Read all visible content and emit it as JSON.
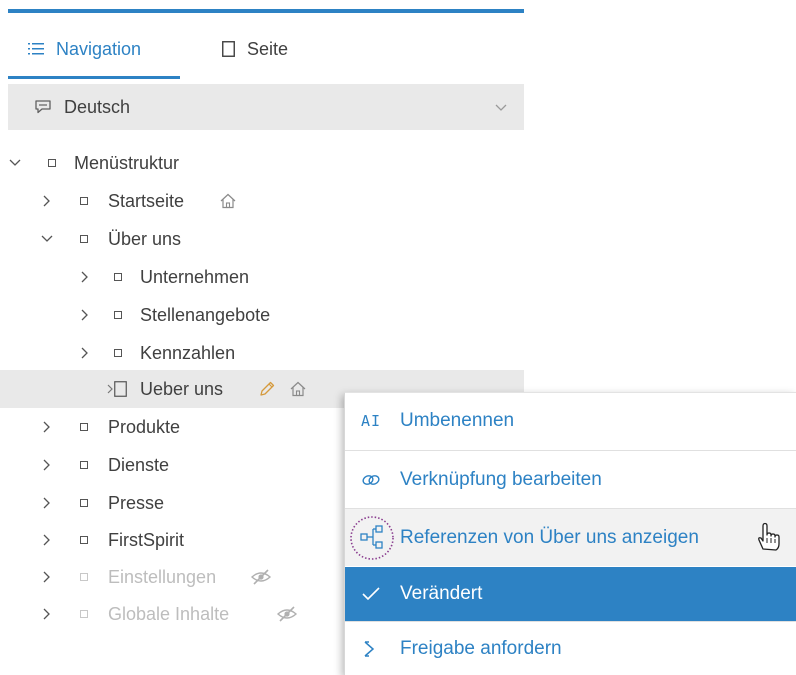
{
  "tabs": {
    "navigation": "Navigation",
    "page": "Seite"
  },
  "language": {
    "selected": "Deutsch"
  },
  "tree": {
    "root": "Menüstruktur",
    "items": [
      "Startseite",
      "Über uns",
      "Unternehmen",
      "Stellenangebote",
      "Kennzahlen",
      "Ueber uns",
      "Produkte",
      "Dienste",
      "Presse",
      "FirstSpirit",
      "Einstellungen",
      "Globale Inhalte"
    ]
  },
  "context_menu": {
    "items": [
      "Umbenennen",
      "Verknüpfung bearbeiten",
      "Referenzen von Über uns anzeigen",
      "Verändert",
      "Freigabe anfordern"
    ],
    "rename_icon_text": "AI"
  },
  "colors": {
    "accent": "#2d82c4",
    "selected_row": "#e9e9e9",
    "muted_text": "#bdbdbd",
    "hover_row": "#f2f2f2",
    "highlight_ring": "#8a3d8f"
  },
  "icons": {
    "nav_tab": "list-icon",
    "page_tab": "page-icon",
    "language": "speech-bubble-icon",
    "home": "home-icon",
    "edit": "pencil-icon",
    "hidden": "eye-slash-icon",
    "rename": "rename-icon",
    "link": "link-icon",
    "references": "sitemap-icon",
    "changed": "checkmark-icon",
    "release": "chevron-stage-icon",
    "cursor": "hand-pointer-icon"
  }
}
